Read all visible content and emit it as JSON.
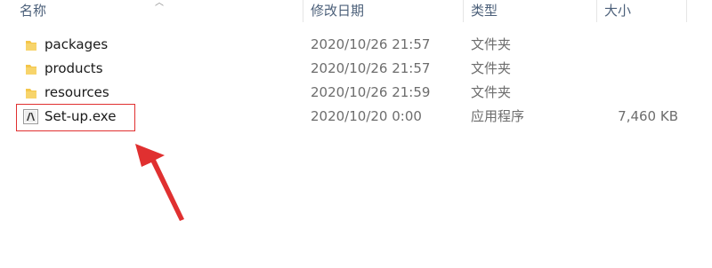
{
  "header": {
    "name": "名称",
    "date": "修改日期",
    "type": "类型",
    "size": "大小"
  },
  "files": [
    {
      "name": "packages",
      "date": "2020/10/26 21:57",
      "type": "文件夹",
      "size": "",
      "icon": "folder-icon"
    },
    {
      "name": "products",
      "date": "2020/10/26 21:57",
      "type": "文件夹",
      "size": "",
      "icon": "folder-icon"
    },
    {
      "name": "resources",
      "date": "2020/10/26 21:59",
      "type": "文件夹",
      "size": "",
      "icon": "folder-icon"
    },
    {
      "name": "Set-up.exe",
      "date": "2020/10/20 0:00",
      "type": "应用程序",
      "size": "7,460 KB",
      "icon": "adobe-exe-icon"
    }
  ],
  "annotation": {
    "color": "#e03030"
  },
  "colors": {
    "header_text": "#4c607a",
    "folder": "#f4c64a",
    "secondary_text": "#6d6d6d"
  }
}
